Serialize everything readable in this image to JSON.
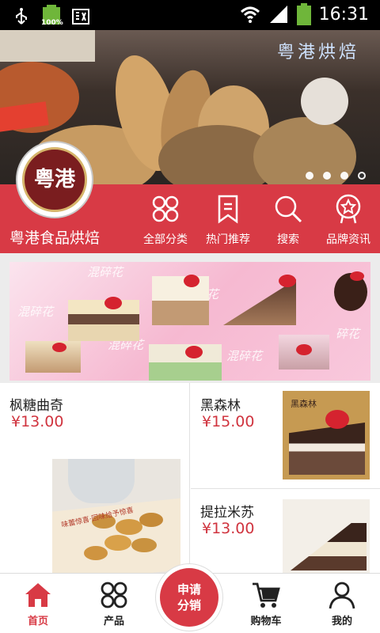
{
  "status_bar": {
    "time": "16:31",
    "battery_badge": "100%",
    "icons": [
      "usb-icon",
      "battery-full-icon",
      "keyboard-icon",
      "wifi-icon",
      "signal-icon",
      "battery-icon"
    ]
  },
  "hero": {
    "banner_text": "粤港烘焙",
    "slides_total": 4,
    "active_slide": 4
  },
  "brand": {
    "logo_text": "粤港",
    "name": "粤港食品烘焙",
    "accent": "#d83a45"
  },
  "nav": [
    {
      "label": "全部分类",
      "icon": "grid-icon"
    },
    {
      "label": "热门推荐",
      "icon": "bookmark-icon"
    },
    {
      "label": "搜索",
      "icon": "search-icon"
    },
    {
      "label": "品牌资讯",
      "icon": "badge-icon"
    }
  ],
  "promo": {
    "words": [
      "混碎花",
      "碎花",
      "混碎花",
      "混碎花",
      "混碎花",
      "碎花"
    ]
  },
  "products": [
    {
      "name": "枫糖曲奇",
      "price": "¥13.00"
    },
    {
      "name": "黑森林",
      "price": "¥15.00",
      "image_caption": "黑森林"
    },
    {
      "name": "提拉米苏",
      "price": "¥13.00"
    }
  ],
  "left_product_image_caption": "味蕾惊喜·回味给予惊喜",
  "tabbar": {
    "tabs": [
      {
        "label": "首页",
        "icon": "home-icon"
      },
      {
        "label": "产品",
        "icon": "products-grid-icon"
      },
      {
        "label": "购物车",
        "icon": "cart-icon"
      },
      {
        "label": "我的",
        "icon": "user-icon"
      }
    ],
    "center_line1": "申请",
    "center_line2": "分销",
    "active_tab": "首页"
  }
}
